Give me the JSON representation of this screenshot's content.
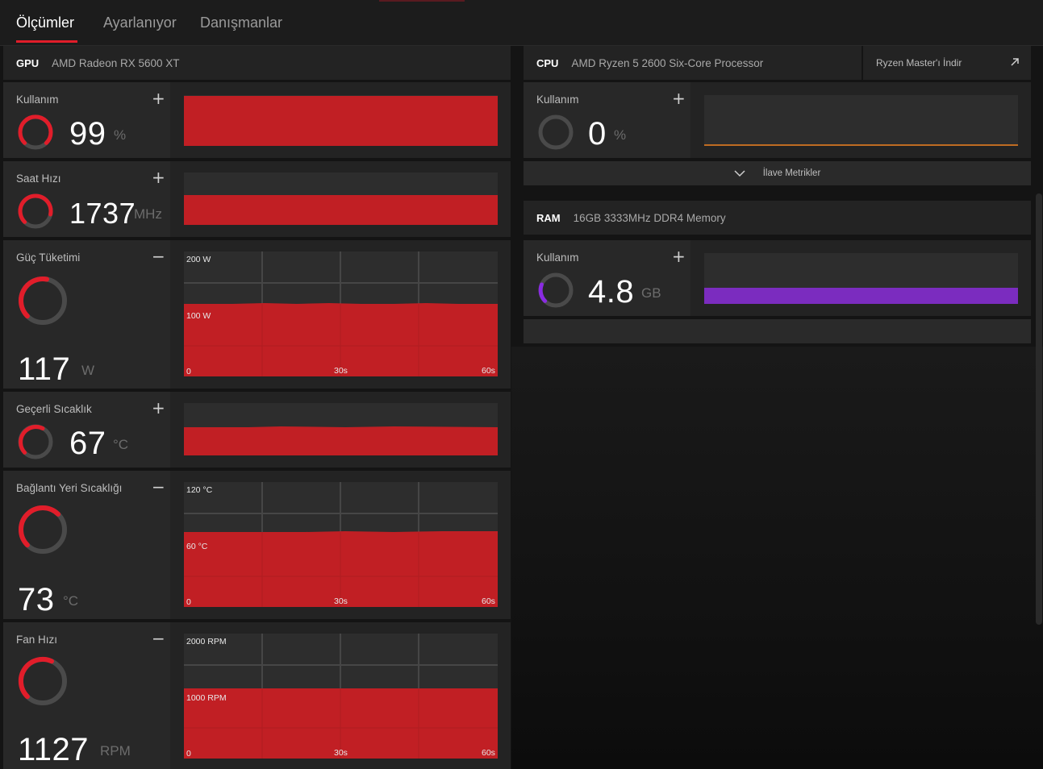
{
  "tabs": [
    {
      "label": "Ölçümler",
      "active": true
    },
    {
      "label": "Ayarlanıyor",
      "active": false
    },
    {
      "label": "Danışmanlar",
      "active": false
    }
  ],
  "gpu": {
    "kind": "GPU",
    "name": "AMD Radeon RX 5600 XT",
    "metrics": {
      "usage": {
        "label": "Kullanım",
        "value": "99",
        "unit": "%",
        "toggle": "+",
        "level": 0.99
      },
      "clock": {
        "label": "Saat Hızı",
        "value": "1737",
        "unit": "MHz",
        "toggle": "+",
        "level": 0.87
      },
      "power": {
        "label": "Güç Tüketimi",
        "value": "117",
        "unit": "W",
        "toggle": "−",
        "level": 0.585,
        "y_labels": [
          "200 W",
          "100 W",
          "0"
        ],
        "x_labels": [
          "30s",
          "60s"
        ]
      },
      "temp": {
        "label": "Geçerli Sıcaklık",
        "value": "67",
        "unit": "°C",
        "toggle": "+",
        "level": 0.67
      },
      "junction": {
        "label": "Bağlantı Yeri Sıcaklığı",
        "value": "73",
        "unit": "°C",
        "toggle": "−",
        "level": 0.61,
        "y_labels": [
          "120 °C",
          "60 °C",
          "0"
        ],
        "x_labels": [
          "30s",
          "60s"
        ]
      },
      "fan": {
        "label": "Fan Hızı",
        "value": "1127",
        "unit": "RPM",
        "toggle": "−",
        "level": 0.56,
        "y_labels": [
          "2000 RPM",
          "1000 RPM",
          "0"
        ],
        "x_labels": [
          "30s",
          "60s"
        ]
      }
    }
  },
  "cpu": {
    "kind": "CPU",
    "name": "AMD Ryzen 5 2600 Six-Core Processor",
    "link_label": "Ryzen Master'ı İndir",
    "usage": {
      "label": "Kullanım",
      "value": "0",
      "unit": "%",
      "toggle": "+",
      "level": 0.0
    },
    "more_label": "İlave Metrikler"
  },
  "ram": {
    "kind": "RAM",
    "name": "16GB 3333MHz DDR4 Memory",
    "usage": {
      "label": "Kullanım",
      "value": "4.8",
      "unit": "GB",
      "toggle": "+",
      "level": 0.3
    }
  },
  "colors": {
    "accent": "#e11d2a",
    "gpu_fill": "#c11f24",
    "cpu_line": "#f0821e",
    "ram_fill": "#7b2cbf",
    "gauge_track": "#4a4a4a",
    "ram_gauge": "#8a2be2"
  },
  "icons": {
    "collapse": "chevron-down-icon",
    "external": "external-link-icon"
  }
}
